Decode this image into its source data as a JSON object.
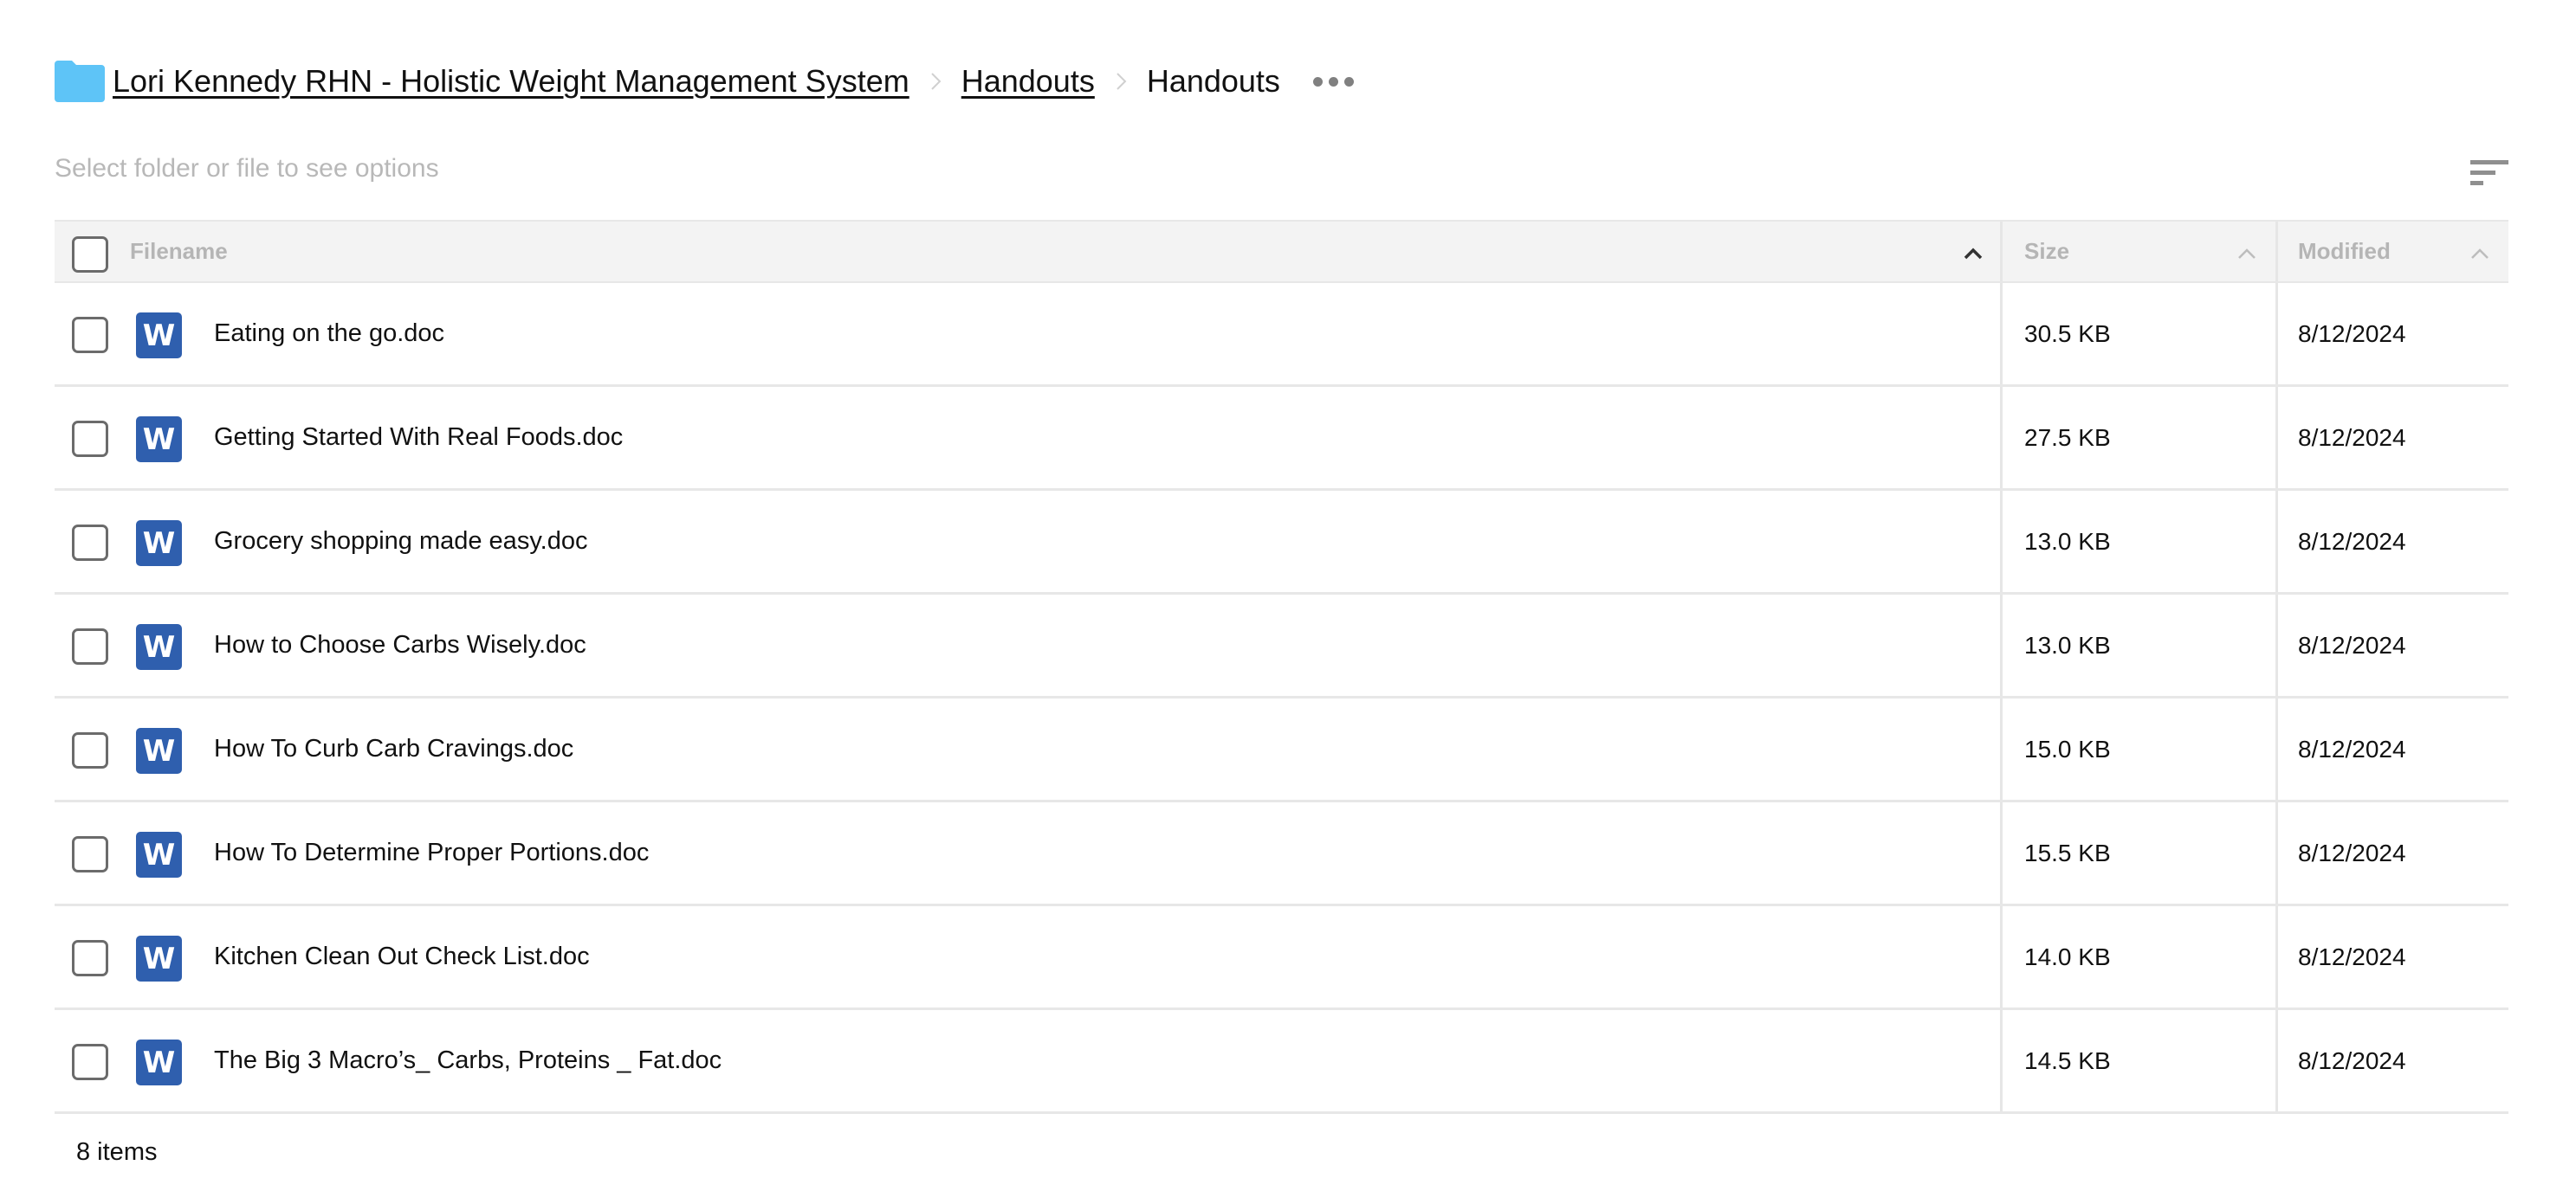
{
  "breadcrumb": {
    "icon": "folder-icon",
    "folder_color": "#5ec4f7",
    "items": [
      {
        "label": "Lori Kennedy RHN - Holistic Weight Management System",
        "link": true
      },
      {
        "label": "Handouts",
        "link": true
      },
      {
        "label": "Handouts",
        "link": false
      }
    ],
    "separator_icon": "chevron-right-icon",
    "more_icon": "more-horizontal-icon"
  },
  "toolbar": {
    "hint": "Select folder or file to see options",
    "sort_icon": "sort-lines-icon"
  },
  "table": {
    "columns": [
      {
        "label": "Filename",
        "sort_icon": "chevron-up-icon",
        "sort_active": true
      },
      {
        "label": "Size",
        "sort_icon": "chevron-up-icon",
        "sort_active": false
      },
      {
        "label": "Modified",
        "sort_icon": "chevron-up-icon",
        "sort_active": false
      }
    ],
    "file_icon": {
      "name": "word-doc-icon",
      "glyph": "W",
      "color": "#2f5fae"
    },
    "rows": [
      {
        "name": "Eating on the go.doc",
        "size": "30.5 KB",
        "modified": "8/12/2024"
      },
      {
        "name": "Getting Started With Real Foods.doc",
        "size": "27.5 KB",
        "modified": "8/12/2024"
      },
      {
        "name": "Grocery shopping made easy.doc",
        "size": "13.0 KB",
        "modified": "8/12/2024"
      },
      {
        "name": "How to Choose Carbs Wisely.doc",
        "size": "13.0 KB",
        "modified": "8/12/2024"
      },
      {
        "name": "How To Curb Carb Cravings.doc",
        "size": "15.0 KB",
        "modified": "8/12/2024"
      },
      {
        "name": "How To Determine Proper Portions.doc",
        "size": "15.5 KB",
        "modified": "8/12/2024"
      },
      {
        "name": "Kitchen Clean Out Check List.doc",
        "size": "14.0 KB",
        "modified": "8/12/2024"
      },
      {
        "name": "The Big 3 Macro’s_ Carbs, Proteins _ Fat.doc",
        "size": "14.5 KB",
        "modified": "8/12/2024"
      }
    ]
  },
  "footer": {
    "item_count": "8 items"
  }
}
